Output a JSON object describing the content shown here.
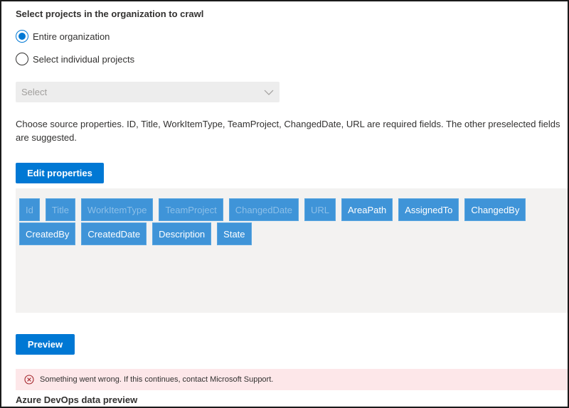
{
  "projects": {
    "title": "Select projects in the organization to crawl",
    "options": [
      {
        "label": "Entire organization",
        "checked": true
      },
      {
        "label": "Select individual projects",
        "checked": false
      }
    ],
    "select": {
      "value": "Select",
      "disabled": true
    }
  },
  "properties": {
    "description": "Choose source properties. ID, Title, WorkItemType, TeamProject, ChangedDate, URL are required fields. The other preselected fields are suggested.",
    "edit_label": "Edit properties",
    "chips": [
      {
        "label": "Id",
        "required": true
      },
      {
        "label": "Title",
        "required": true
      },
      {
        "label": "WorkItemType",
        "required": true
      },
      {
        "label": "TeamProject",
        "required": true
      },
      {
        "label": "ChangedDate",
        "required": true
      },
      {
        "label": "URL",
        "required": true
      },
      {
        "label": "AreaPath",
        "required": false
      },
      {
        "label": "AssignedTo",
        "required": false
      },
      {
        "label": "ChangedBy",
        "required": false
      },
      {
        "label": "CreatedBy",
        "required": false
      },
      {
        "label": "CreatedDate",
        "required": false
      },
      {
        "label": "Description",
        "required": false
      },
      {
        "label": "State",
        "required": false
      }
    ]
  },
  "preview": {
    "button_label": "Preview",
    "error": {
      "icon": "error-circle-icon",
      "message": "Something went wrong. If this continues, contact Microsoft Support."
    },
    "section_title": "Azure DevOps data preview"
  },
  "colors": {
    "accent": "#0078d4",
    "chip": "#3f94d8",
    "error_bg": "#fde7e9",
    "error_icon": "#a4262c"
  }
}
